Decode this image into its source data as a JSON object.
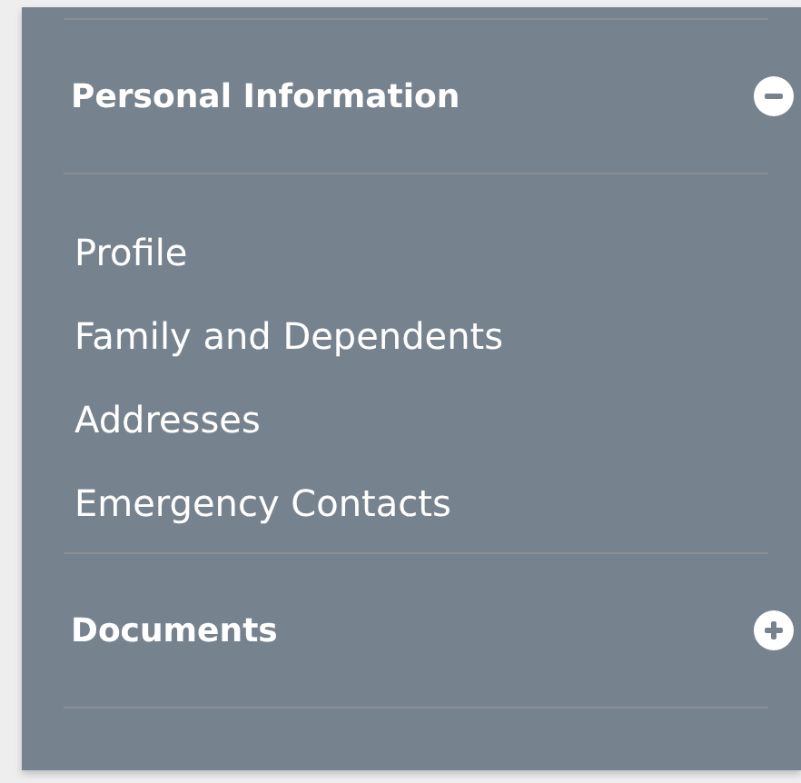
{
  "sections": [
    {
      "title": "Personal Information",
      "expanded": true,
      "items": [
        "Profile",
        "Family and Dependents",
        "Addresses",
        "Emergency Contacts"
      ]
    },
    {
      "title": "Documents",
      "expanded": false
    }
  ]
}
